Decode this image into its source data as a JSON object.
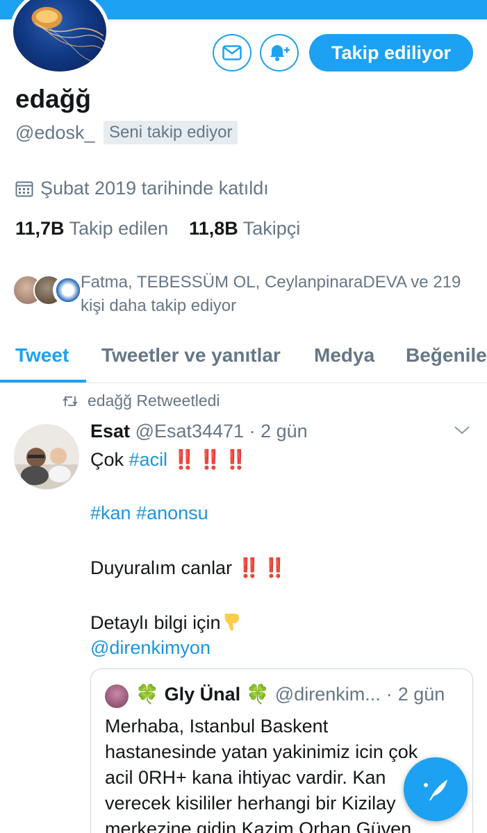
{
  "colors": {
    "accent": "#1da1f2",
    "muted_text": "#657786",
    "primary_text": "#14171a",
    "alert_red": "#e0245e"
  },
  "profile": {
    "name": "edağğ",
    "handle": "@edosk_",
    "follows_you": "Seni takip ediyor",
    "joined": "Şubat 2019 tarihinde katıldı",
    "following_count": "11,7B",
    "following_label": "Takip edilen",
    "followers_count": "11,8B",
    "followers_label": "Takipçi",
    "mutuals_line1": "Fatma, TEBESSÜM OL, CeylanpinaraDEVA ve 219",
    "mutuals_line2": "kişi daha takip ediyor"
  },
  "actions": {
    "message_icon": "envelope-icon",
    "notify_icon": "bell-plus-icon",
    "follow_label": "Takip ediliyor"
  },
  "tabs": [
    {
      "label": "Tweet",
      "active": true
    },
    {
      "label": "Tweetler ve yanıtlar",
      "active": false
    },
    {
      "label": "Medya",
      "active": false
    },
    {
      "label": "Beğenile",
      "active": false
    }
  ],
  "tweet": {
    "retweet_label": "edağğ Retweetledi",
    "author_name": "Esat",
    "author_handle": "@Esat34471",
    "time": "2 gün",
    "line1_text": "Çok ",
    "line1_tag": "#acil",
    "line1_bangs": "‼️ ‼️ ‼️",
    "line2_tags": "#kan #anonsu",
    "line3_text": "Duyuralım canlar ",
    "line3_bangs": "‼️ ‼️",
    "line4_text": "Detaylı bilgi için",
    "mention": "@direnkimyon"
  },
  "quote": {
    "clover_left": "🍀",
    "author_name": "Gly Ünal",
    "clover_right": "🍀",
    "author_handle": "@direnkim...",
    "time": "2 gün",
    "body": "Merhaba, Istanbul Baskent hastanesinde yatan yakinimiz icin çok acil 0RH+ kana ihtiyac vardir. Kan verecek kisililer herhangi bir Kizilay merkezine gidin Kazim Orhan Güven"
  },
  "fab": {
    "icon": "compose-tweet-icon"
  }
}
